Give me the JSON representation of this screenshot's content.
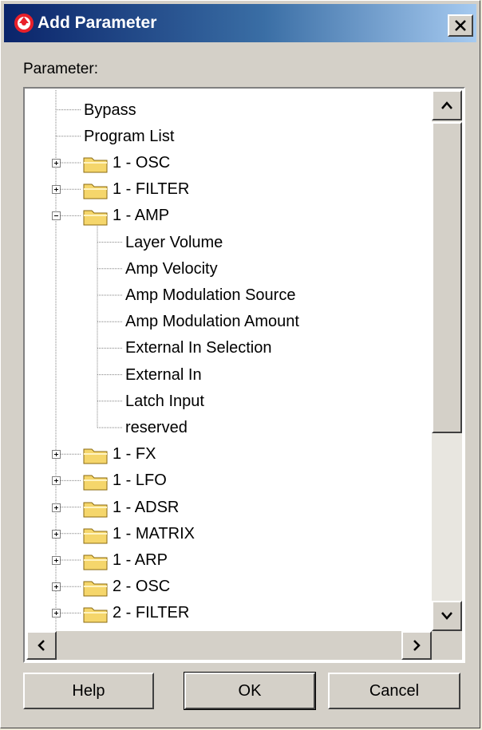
{
  "window": {
    "title": "Add Parameter",
    "close_label": "✕"
  },
  "parameter_label": "Parameter:",
  "tree": {
    "items": [
      {
        "label": "Bypass",
        "level": 0,
        "type": "leaf"
      },
      {
        "label": "Program List",
        "level": 0,
        "type": "leaf"
      },
      {
        "label": "1 - OSC",
        "level": 0,
        "type": "folder",
        "expanded": false
      },
      {
        "label": "1 - FILTER",
        "level": 0,
        "type": "folder",
        "expanded": false
      },
      {
        "label": "1 - AMP",
        "level": 0,
        "type": "folder",
        "expanded": true
      },
      {
        "label": "Layer Volume",
        "level": 1,
        "type": "leaf"
      },
      {
        "label": "Amp Velocity",
        "level": 1,
        "type": "leaf"
      },
      {
        "label": "Amp Modulation Source",
        "level": 1,
        "type": "leaf"
      },
      {
        "label": "Amp Modulation Amount",
        "level": 1,
        "type": "leaf"
      },
      {
        "label": "External In Selection",
        "level": 1,
        "type": "leaf"
      },
      {
        "label": "External In",
        "level": 1,
        "type": "leaf"
      },
      {
        "label": "Latch Input",
        "level": 1,
        "type": "leaf"
      },
      {
        "label": "reserved",
        "level": 1,
        "type": "leaf"
      },
      {
        "label": "1 - FX",
        "level": 0,
        "type": "folder",
        "expanded": false
      },
      {
        "label": "1 - LFO",
        "level": 0,
        "type": "folder",
        "expanded": false
      },
      {
        "label": "1 - ADSR",
        "level": 0,
        "type": "folder",
        "expanded": false
      },
      {
        "label": "1 - MATRIX",
        "level": 0,
        "type": "folder",
        "expanded": false
      },
      {
        "label": "1 - ARP",
        "level": 0,
        "type": "folder",
        "expanded": false
      },
      {
        "label": "2 - OSC",
        "level": 0,
        "type": "folder",
        "expanded": false
      },
      {
        "label": "2 - FILTER",
        "level": 0,
        "type": "folder",
        "expanded": false
      }
    ]
  },
  "buttons": {
    "help": "Help",
    "ok": "OK",
    "cancel": "Cancel"
  },
  "icons": {
    "app": "cubase-logo-icon",
    "folder": "folder-icon",
    "scroll_up": "arrow-up-icon",
    "scroll_down": "arrow-down-icon",
    "scroll_left": "arrow-left-icon",
    "scroll_right": "arrow-right-icon"
  },
  "colors": {
    "title_start": "#0a246a",
    "title_end": "#a6caf0",
    "folder": "#f5d66b",
    "face": "#d4d0c8"
  }
}
